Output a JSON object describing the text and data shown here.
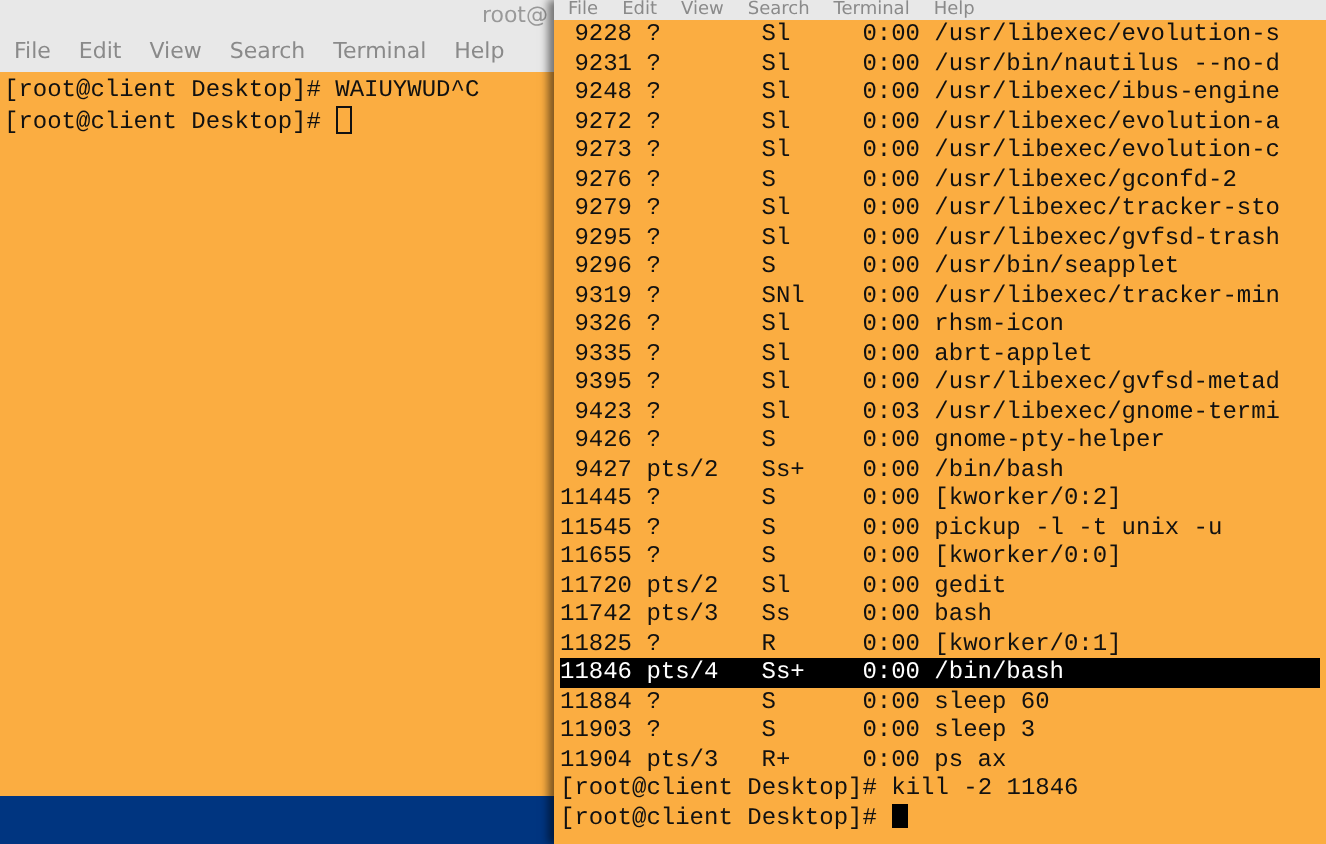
{
  "left_terminal": {
    "title": "root@",
    "menu": [
      "File",
      "Edit",
      "View",
      "Search",
      "Terminal",
      "Help"
    ],
    "focused": false,
    "lines": [
      {
        "prompt": "[root@client Desktop]#",
        "input": "WAIUYWUD^C"
      },
      {
        "prompt": "[root@client Desktop]#"
      }
    ]
  },
  "right_terminal": {
    "menu": [
      "File",
      "Edit",
      "View",
      "Search",
      "Terminal",
      "Help"
    ],
    "focused": true,
    "process_rows": [
      {
        "pid": "9228",
        "tty": "?",
        "stat": "Sl",
        "time": "0:00",
        "command": "/usr/libexec/evolution-s",
        "selected": false
      },
      {
        "pid": "9231",
        "tty": "?",
        "stat": "Sl",
        "time": "0:00",
        "command": "/usr/bin/nautilus --no-d",
        "selected": false
      },
      {
        "pid": "9248",
        "tty": "?",
        "stat": "Sl",
        "time": "0:00",
        "command": "/usr/libexec/ibus-engine",
        "selected": false
      },
      {
        "pid": "9272",
        "tty": "?",
        "stat": "Sl",
        "time": "0:00",
        "command": "/usr/libexec/evolution-a",
        "selected": false
      },
      {
        "pid": "9273",
        "tty": "?",
        "stat": "Sl",
        "time": "0:00",
        "command": "/usr/libexec/evolution-c",
        "selected": false
      },
      {
        "pid": "9276",
        "tty": "?",
        "stat": "S",
        "time": "0:00",
        "command": "/usr/libexec/gconfd-2",
        "selected": false
      },
      {
        "pid": "9279",
        "tty": "?",
        "stat": "Sl",
        "time": "0:00",
        "command": "/usr/libexec/tracker-sto",
        "selected": false
      },
      {
        "pid": "9295",
        "tty": "?",
        "stat": "Sl",
        "time": "0:00",
        "command": "/usr/libexec/gvfsd-trash",
        "selected": false
      },
      {
        "pid": "9296",
        "tty": "?",
        "stat": "S",
        "time": "0:00",
        "command": "/usr/bin/seapplet",
        "selected": false
      },
      {
        "pid": "9319",
        "tty": "?",
        "stat": "SNl",
        "time": "0:00",
        "command": "/usr/libexec/tracker-min",
        "selected": false
      },
      {
        "pid": "9326",
        "tty": "?",
        "stat": "Sl",
        "time": "0:00",
        "command": "rhsm-icon",
        "selected": false
      },
      {
        "pid": "9335",
        "tty": "?",
        "stat": "Sl",
        "time": "0:00",
        "command": "abrt-applet",
        "selected": false
      },
      {
        "pid": "9395",
        "tty": "?",
        "stat": "Sl",
        "time": "0:00",
        "command": "/usr/libexec/gvfsd-metad",
        "selected": false
      },
      {
        "pid": "9423",
        "tty": "?",
        "stat": "Sl",
        "time": "0:03",
        "command": "/usr/libexec/gnome-termi",
        "selected": false
      },
      {
        "pid": "9426",
        "tty": "?",
        "stat": "S",
        "time": "0:00",
        "command": "gnome-pty-helper",
        "selected": false
      },
      {
        "pid": "9427",
        "tty": "pts/2",
        "stat": "Ss+",
        "time": "0:00",
        "command": "/bin/bash",
        "selected": false
      },
      {
        "pid": "11445",
        "tty": "?",
        "stat": "S",
        "time": "0:00",
        "command": "[kworker/0:2]",
        "selected": false
      },
      {
        "pid": "11545",
        "tty": "?",
        "stat": "S",
        "time": "0:00",
        "command": "pickup -l -t unix -u",
        "selected": false
      },
      {
        "pid": "11655",
        "tty": "?",
        "stat": "S",
        "time": "0:00",
        "command": "[kworker/0:0]",
        "selected": false
      },
      {
        "pid": "11720",
        "tty": "pts/2",
        "stat": "Sl",
        "time": "0:00",
        "command": "gedit",
        "selected": false
      },
      {
        "pid": "11742",
        "tty": "pts/3",
        "stat": "Ss",
        "time": "0:00",
        "command": "bash",
        "selected": false
      },
      {
        "pid": "11825",
        "tty": "?",
        "stat": "R",
        "time": "0:00",
        "command": "[kworker/0:1]",
        "selected": false
      },
      {
        "pid": "11846",
        "tty": "pts/4",
        "stat": "Ss+",
        "time": "0:00",
        "command": "/bin/bash",
        "selected": true
      },
      {
        "pid": "11884",
        "tty": "?",
        "stat": "S",
        "time": "0:00",
        "command": "sleep 60",
        "selected": false
      },
      {
        "pid": "11903",
        "tty": "?",
        "stat": "S",
        "time": "0:00",
        "command": "sleep 3",
        "selected": false
      },
      {
        "pid": "11904",
        "tty": "pts/3",
        "stat": "R+",
        "time": "0:00",
        "command": "ps ax",
        "selected": false
      }
    ],
    "lines": [
      {
        "prompt": "[root@client Desktop]#",
        "input": "kill -2 11846"
      },
      {
        "prompt": "[root@client Desktop]#"
      }
    ]
  }
}
